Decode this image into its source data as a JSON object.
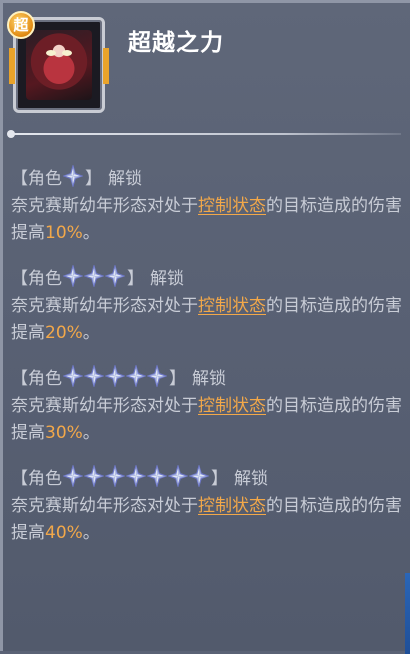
{
  "skill": {
    "badge": "超",
    "title": "超越之力"
  },
  "tiers": [
    {
      "bracket_open": "【角色",
      "bracket_close": "】",
      "stars": 1,
      "unlock": "解锁",
      "desc_prefix": "奈克赛斯幼年形态对处于",
      "highlight": "控制状态",
      "desc_mid": "的目标造成的伤害提高",
      "percent": "10%",
      "desc_suffix": "。"
    },
    {
      "bracket_open": "【角色",
      "bracket_close": "】",
      "stars": 3,
      "unlock": "解锁",
      "desc_prefix": "奈克赛斯幼年形态对处于",
      "highlight": "控制状态",
      "desc_mid": "的目标造成的伤害提高",
      "percent": "20%",
      "desc_suffix": "。"
    },
    {
      "bracket_open": "【角色",
      "bracket_close": "】",
      "stars": 5,
      "unlock": "解锁",
      "desc_prefix": "奈克赛斯幼年形态对处于",
      "highlight": "控制状态",
      "desc_mid": "的目标造成的伤害提高",
      "percent": "30%",
      "desc_suffix": "。"
    },
    {
      "bracket_open": "【角色",
      "bracket_close": "】",
      "stars": 7,
      "unlock": "解锁",
      "desc_prefix": "奈克赛斯幼年形态对处于",
      "highlight": "控制状态",
      "desc_mid": "的目标造成的伤害提高",
      "percent": "40%",
      "desc_suffix": "。"
    }
  ],
  "colors": {
    "highlight": "#f2a84a",
    "text": "#c8ccd6",
    "title": "#ffffff",
    "star_fill": "#dfe6f4",
    "star_edge": "#6e78c8"
  },
  "icons": {
    "star": "shuriken-star-icon",
    "badge": "super-badge-icon"
  }
}
